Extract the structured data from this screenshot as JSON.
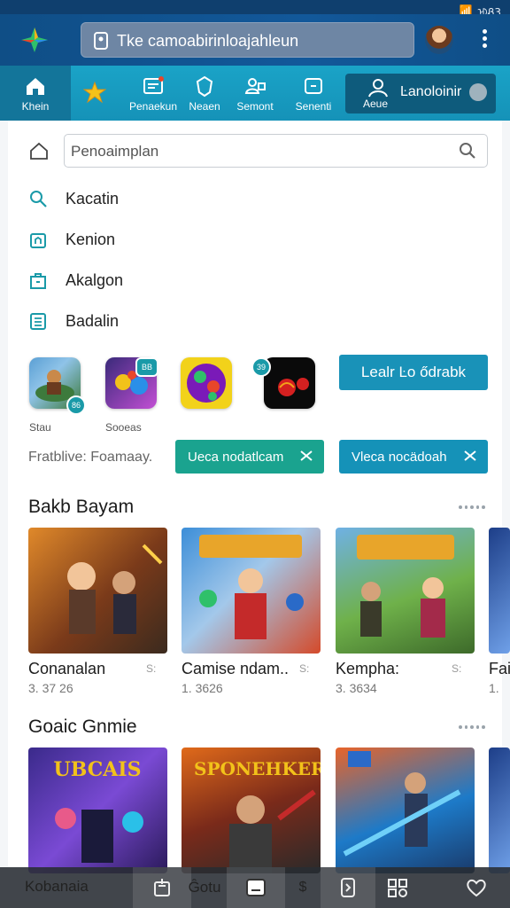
{
  "status_bar": {
    "time": "ᡅᏰ3"
  },
  "top_bar": {
    "search_text": "Tke camoabirinloajahleun",
    "brand_color": "#12589a"
  },
  "nav": {
    "items": [
      {
        "label": "Khein",
        "icon": "home-icon",
        "active": true
      },
      {
        "label": "",
        "icon": "star-icon",
        "active": false
      },
      {
        "label": "Penaekun",
        "icon": "mail-icon",
        "active": false
      },
      {
        "label": "Neaen",
        "icon": "shield-icon",
        "active": false
      },
      {
        "label": "Semont",
        "icon": "people-icon",
        "active": false
      },
      {
        "label": "Senenti",
        "icon": "tablet-icon",
        "active": false
      }
    ],
    "special": {
      "label_small": "Aeue",
      "label": "Ŀanoloinir",
      "icon": "user-icon"
    }
  },
  "search": {
    "placeholder": "Penoaimplan"
  },
  "menu": [
    {
      "label": "Kacatin",
      "icon": "search-icon"
    },
    {
      "label": "Kenion",
      "icon": "home-outline-icon"
    },
    {
      "label": "Akalgon",
      "icon": "bag-icon"
    },
    {
      "label": "Badalin",
      "icon": "list-icon"
    }
  ],
  "apps": [
    {
      "caption": "Stau",
      "badge": "86",
      "colors": [
        "#5a9fd4",
        "#3d7a3c"
      ]
    },
    {
      "caption": "Sooeas",
      "badge": "BB",
      "colors": [
        "#3a2a7a",
        "#c24fd4"
      ]
    },
    {
      "caption": "",
      "badge": "",
      "colors": [
        "#e8d21a",
        "#7a1ab8"
      ]
    },
    {
      "caption": "",
      "badge": "39",
      "colors": [
        "#0a0a0a",
        "#d42020"
      ]
    }
  ],
  "primary_button": "Lealr Ŀo ődrabk",
  "featured": {
    "label": "Fratblive: Foamaay.",
    "buttons": [
      {
        "label": "Ueca nodatlcam",
        "color": "#1aa38f"
      },
      {
        "label": "Vleca nocädoah",
        "color": "#1592b8"
      }
    ]
  },
  "sections": [
    {
      "title": "Bakb Bayam",
      "tiles": [
        {
          "title": "Conanalan",
          "sub": "3. 37 26",
          "meta": "S:",
          "colors": [
            "#e0892a",
            "#3b2a1e"
          ]
        },
        {
          "title": "Camise ndam..",
          "sub": "1. 3626",
          "meta": "S:",
          "colors": [
            "#3c8ed8",
            "#d44a2a"
          ]
        },
        {
          "title": "Kempha:",
          "sub": "3. 3634",
          "meta": "S:",
          "colors": [
            "#6fb14a",
            "#a32a4a"
          ]
        },
        {
          "title": "Fai",
          "sub": "1.",
          "meta": "",
          "colors": [
            "#1d3e88",
            "#6fa0e8"
          ]
        }
      ]
    },
    {
      "title": "Goaic Gnmie",
      "tiles": [
        {
          "title": "",
          "sub": "",
          "meta": "",
          "banner": "UBCAIS",
          "colors": [
            "#3a2a8a",
            "#e8a52a"
          ]
        },
        {
          "title": "",
          "sub": "",
          "meta": "",
          "banner": "SPONEHKER",
          "colors": [
            "#e06a1a",
            "#2a2a2a"
          ]
        },
        {
          "title": "",
          "sub": "",
          "meta": "",
          "banner": "",
          "colors": [
            "#1d7ac8",
            "#e8642a"
          ]
        },
        {
          "title": "",
          "sub": "",
          "meta": "",
          "banner": "",
          "colors": [
            "#1d3e88",
            "#6fa0e8"
          ]
        }
      ]
    }
  ],
  "bottom_bar": {
    "items": [
      {
        "label": "Kobanaia",
        "icon": "k-icon"
      },
      {
        "label": "",
        "icon": "share-icon"
      },
      {
        "label": "Ĝotu",
        "icon": ""
      },
      {
        "label": "",
        "icon": "inbox-icon"
      },
      {
        "label": "$",
        "icon": ""
      },
      {
        "label": "",
        "icon": "device-icon"
      },
      {
        "label": "",
        "icon": "grid-icon"
      },
      {
        "label": "",
        "icon": "heart-icon"
      }
    ]
  }
}
